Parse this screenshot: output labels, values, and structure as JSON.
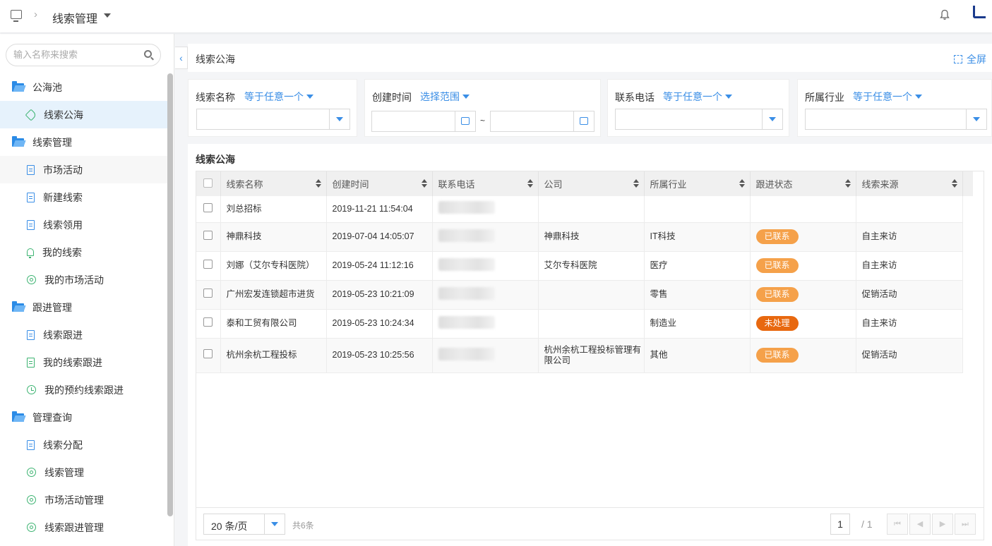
{
  "topbar": {
    "title": "线索管理"
  },
  "sidebar": {
    "search_placeholder": "输入名称来搜索",
    "items": [
      {
        "label": "公海池",
        "type": "group"
      },
      {
        "label": "线索公海",
        "type": "child",
        "icon": "tag-icon",
        "active": true
      },
      {
        "label": "线索管理",
        "type": "group"
      },
      {
        "label": "市场活动",
        "type": "child",
        "icon": "document-icon"
      },
      {
        "label": "新建线索",
        "type": "child",
        "icon": "document-icon"
      },
      {
        "label": "线索领用",
        "type": "child",
        "icon": "document-icon"
      },
      {
        "label": "我的线索",
        "type": "child",
        "icon": "bell-icon"
      },
      {
        "label": "我的市场活动",
        "type": "child",
        "icon": "target-icon"
      },
      {
        "label": "跟进管理",
        "type": "group"
      },
      {
        "label": "线索跟进",
        "type": "child",
        "icon": "document-icon"
      },
      {
        "label": "我的线索跟进",
        "type": "child",
        "icon": "clipboard-icon"
      },
      {
        "label": "我的预约线索跟进",
        "type": "child",
        "icon": "clock-icon"
      },
      {
        "label": "管理查询",
        "type": "group"
      },
      {
        "label": "线索分配",
        "type": "child",
        "icon": "document-icon"
      },
      {
        "label": "线索管理",
        "type": "child",
        "icon": "target-icon"
      },
      {
        "label": "市场活动管理",
        "type": "child",
        "icon": "target-icon"
      },
      {
        "label": "线索跟进管理",
        "type": "child",
        "icon": "target-icon"
      }
    ]
  },
  "main": {
    "title": "线索公海",
    "fullscreen_label": "全屏",
    "filters": {
      "name": {
        "label": "线索名称",
        "op": "等于任意一个"
      },
      "created": {
        "label": "创建时间",
        "op": "选择范围",
        "separator": "~"
      },
      "phone": {
        "label": "联系电话",
        "op": "等于任意一个"
      },
      "industry": {
        "label": "所属行业",
        "op": "等于任意一个"
      }
    },
    "table": {
      "title": "线索公海",
      "columns": [
        "线索名称",
        "创建时间",
        "联系电话",
        "公司",
        "所属行业",
        "跟进状态",
        "线索来源"
      ],
      "rows": [
        {
          "name": "刘总招标",
          "created": "2019-11-21 11:54:04",
          "company": "",
          "industry": "",
          "status": "",
          "source": ""
        },
        {
          "name": "神鼎科技",
          "created": "2019-07-04 14:05:07",
          "company": "神鼎科技",
          "industry": "IT科技",
          "status": "已联系",
          "source": "自主来访"
        },
        {
          "name": "刘娜（艾尔专科医院）",
          "created": "2019-05-24 11:12:16",
          "company": "艾尔专科医院",
          "industry": "医疗",
          "status": "已联系",
          "source": "自主来访"
        },
        {
          "name": "广州宏发连锁超市进货",
          "created": "2019-05-23 10:21:09",
          "company": "",
          "industry": "零售",
          "status": "已联系",
          "source": "促销活动"
        },
        {
          "name": "泰和工贸有限公司",
          "created": "2019-05-23 10:24:34",
          "company": "",
          "industry": "制造业",
          "status": "未处理",
          "source": "自主来访"
        },
        {
          "name": "杭州余杭工程投标",
          "created": "2019-05-23 10:25:56",
          "company": "杭州余杭工程投标管理有限公司",
          "industry": "其他",
          "status": "已联系",
          "source": "促销活动"
        }
      ],
      "status_colors": {
        "已联系": "#f5a14a",
        "未处理": "#e8680f"
      }
    },
    "pager": {
      "page_size": "20 条/页",
      "total": "共6条",
      "current": "1",
      "of": "/ 1"
    }
  },
  "colors": {
    "accent": "#3a8ee6",
    "active_bg": "#e6f2fc"
  }
}
